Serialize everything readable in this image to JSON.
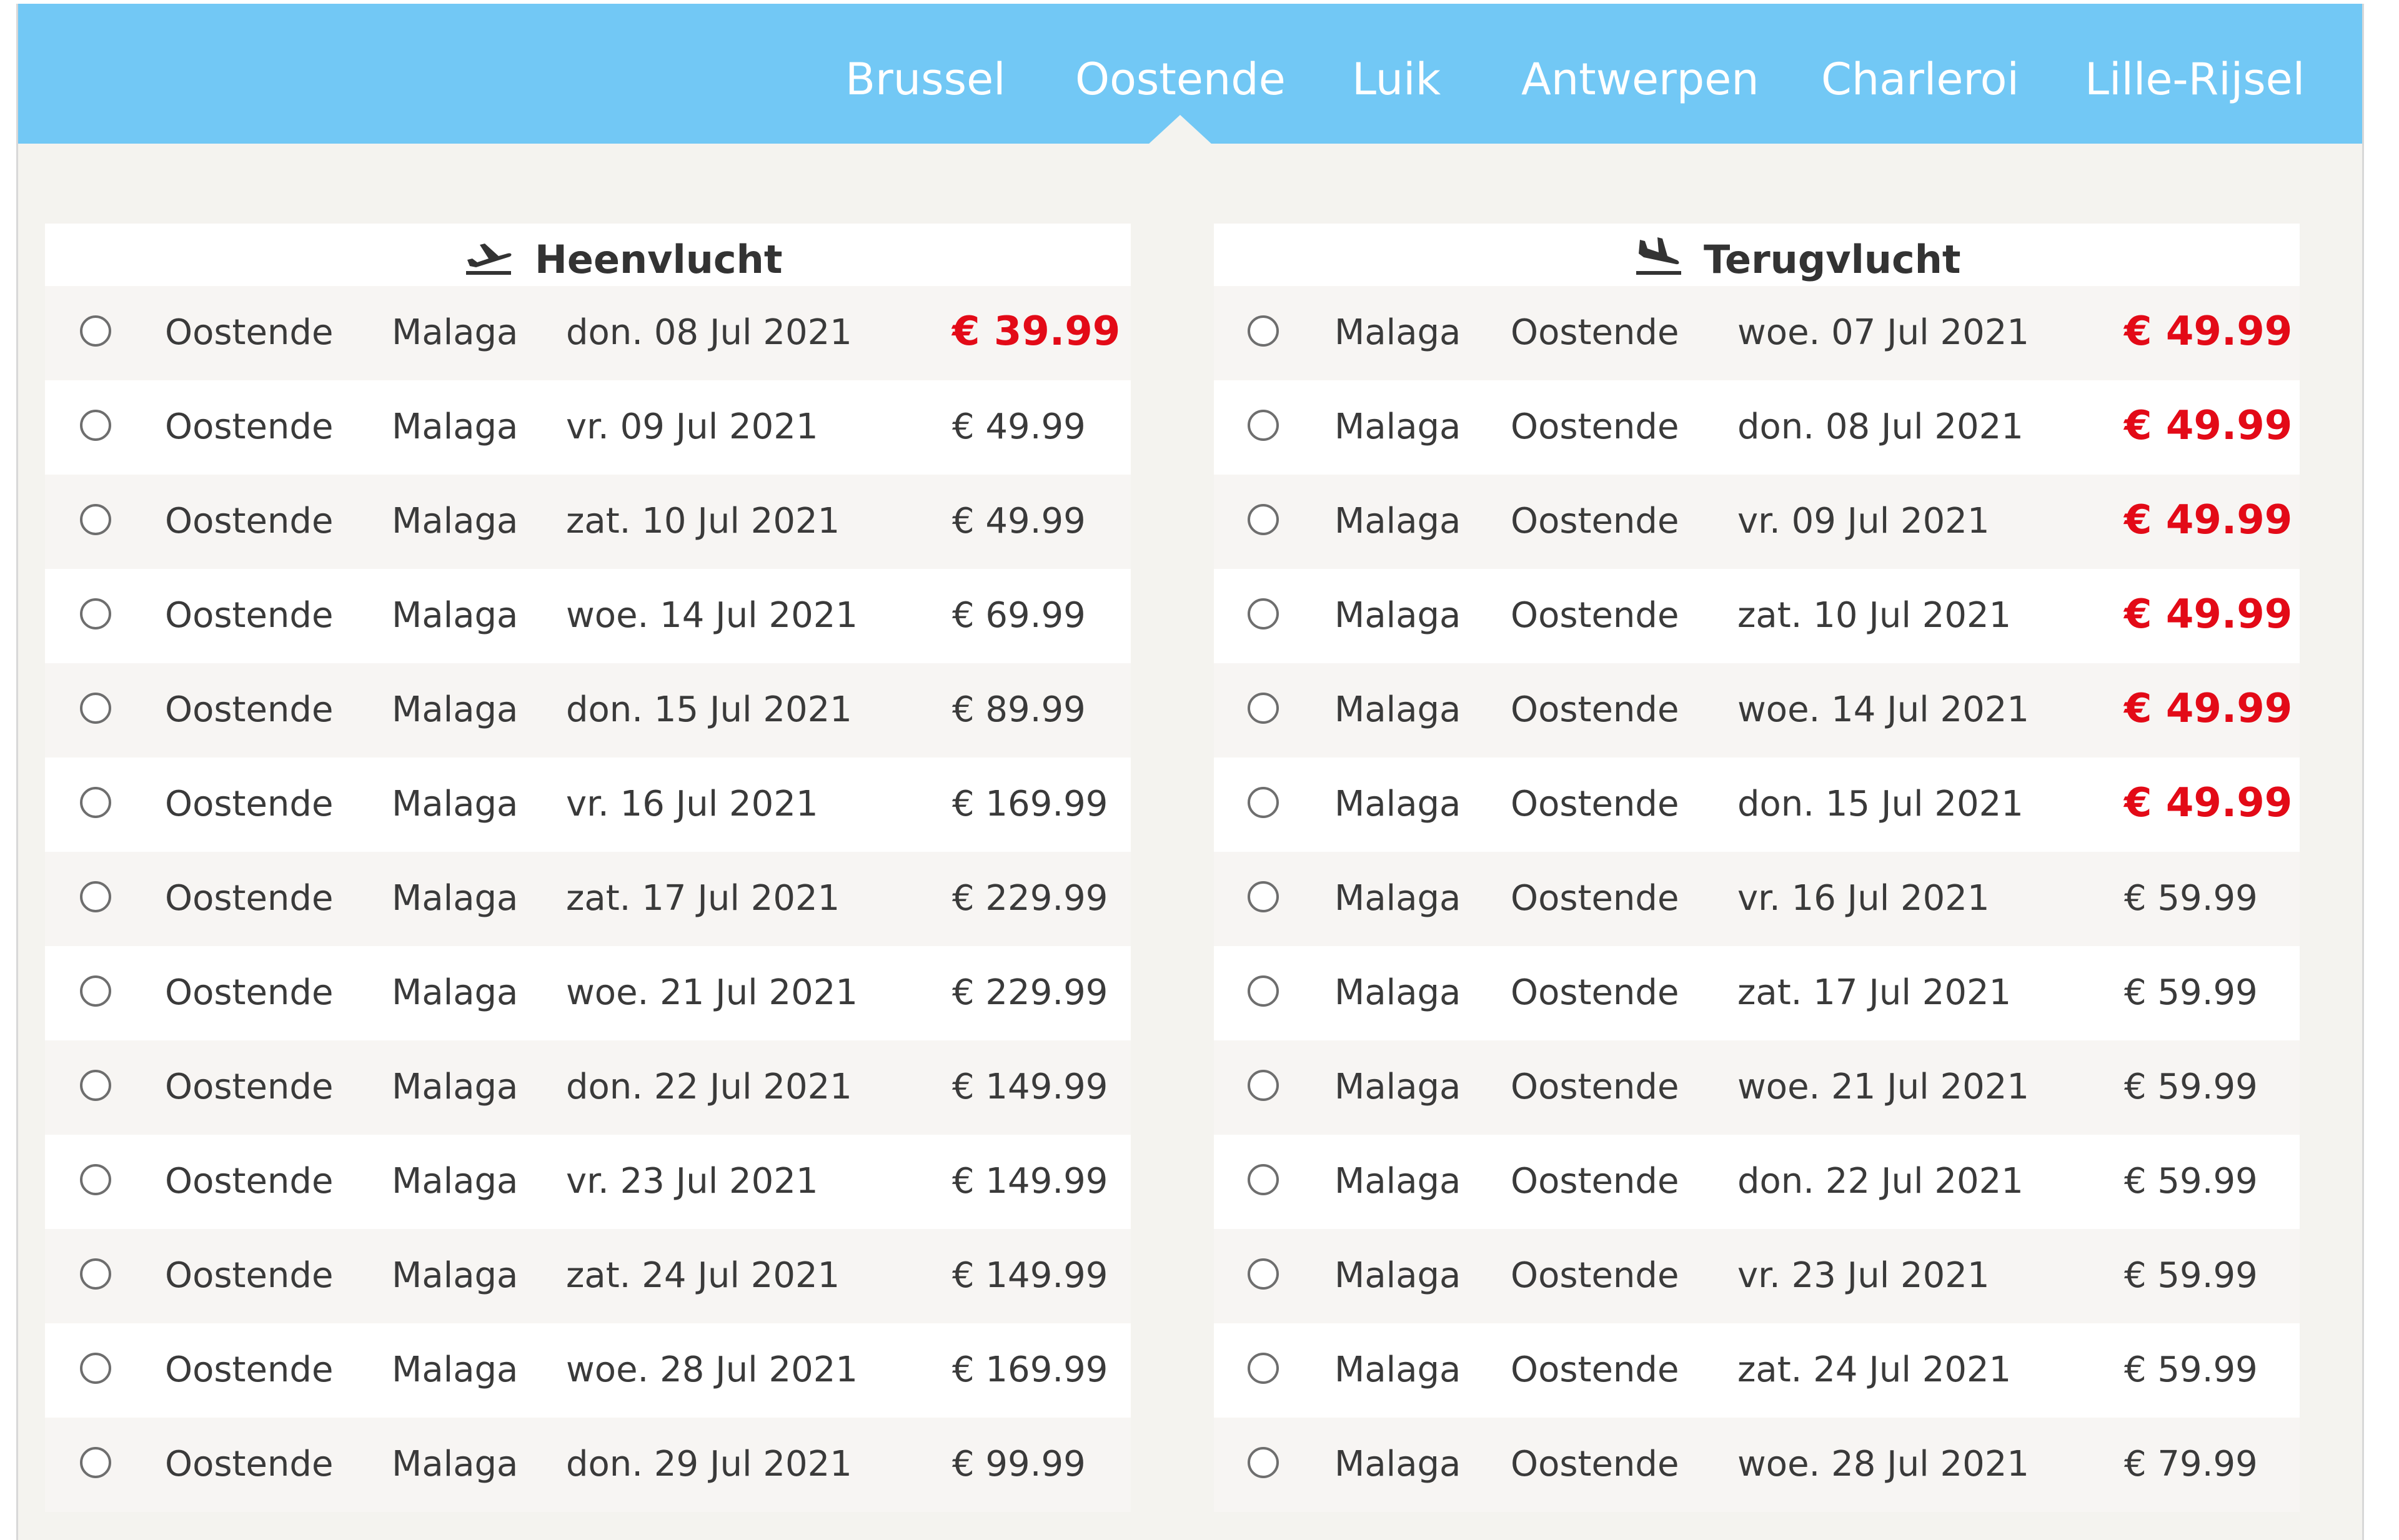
{
  "tabs": [
    {
      "label": "Brussel",
      "active": false
    },
    {
      "label": "Oostende",
      "active": true
    },
    {
      "label": "Luik",
      "active": false
    },
    {
      "label": "Antwerpen",
      "active": false
    },
    {
      "label": "Charleroi",
      "active": false
    },
    {
      "label": "Lille-Rijsel",
      "active": false
    }
  ],
  "colors": {
    "header": "#72c8f5",
    "price_highlight": "#e30a17",
    "background": "#f4f3ef"
  },
  "outbound": {
    "title": "Heenvlucht",
    "icon": "plane-departure-icon",
    "flights": [
      {
        "from": "Oostende",
        "to": "Malaga",
        "date": "don. 08 Jul 2021",
        "price": "€ 39.99",
        "highlight": true
      },
      {
        "from": "Oostende",
        "to": "Malaga",
        "date": "vr. 09 Jul 2021",
        "price": "€ 49.99",
        "highlight": false
      },
      {
        "from": "Oostende",
        "to": "Malaga",
        "date": "zat. 10 Jul 2021",
        "price": "€ 49.99",
        "highlight": false
      },
      {
        "from": "Oostende",
        "to": "Malaga",
        "date": "woe. 14 Jul 2021",
        "price": "€ 69.99",
        "highlight": false
      },
      {
        "from": "Oostende",
        "to": "Malaga",
        "date": "don. 15 Jul 2021",
        "price": "€ 89.99",
        "highlight": false
      },
      {
        "from": "Oostende",
        "to": "Malaga",
        "date": "vr. 16 Jul 2021",
        "price": "€ 169.99",
        "highlight": false
      },
      {
        "from": "Oostende",
        "to": "Malaga",
        "date": "zat. 17 Jul 2021",
        "price": "€ 229.99",
        "highlight": false
      },
      {
        "from": "Oostende",
        "to": "Malaga",
        "date": "woe. 21 Jul 2021",
        "price": "€ 229.99",
        "highlight": false
      },
      {
        "from": "Oostende",
        "to": "Malaga",
        "date": "don. 22 Jul 2021",
        "price": "€ 149.99",
        "highlight": false
      },
      {
        "from": "Oostende",
        "to": "Malaga",
        "date": "vr. 23 Jul 2021",
        "price": "€ 149.99",
        "highlight": false
      },
      {
        "from": "Oostende",
        "to": "Malaga",
        "date": "zat. 24 Jul 2021",
        "price": "€ 149.99",
        "highlight": false
      },
      {
        "from": "Oostende",
        "to": "Malaga",
        "date": "woe. 28 Jul 2021",
        "price": "€ 169.99",
        "highlight": false
      },
      {
        "from": "Oostende",
        "to": "Malaga",
        "date": "don. 29 Jul 2021",
        "price": "€ 99.99",
        "highlight": false
      }
    ]
  },
  "return": {
    "title": "Terugvlucht",
    "icon": "plane-arrival-icon",
    "flights": [
      {
        "from": "Malaga",
        "to": "Oostende",
        "date": "woe. 07 Jul 2021",
        "price": "€ 49.99",
        "highlight": true
      },
      {
        "from": "Malaga",
        "to": "Oostende",
        "date": "don. 08 Jul 2021",
        "price": "€ 49.99",
        "highlight": true
      },
      {
        "from": "Malaga",
        "to": "Oostende",
        "date": "vr. 09 Jul 2021",
        "price": "€ 49.99",
        "highlight": true
      },
      {
        "from": "Malaga",
        "to": "Oostende",
        "date": "zat. 10 Jul 2021",
        "price": "€ 49.99",
        "highlight": true
      },
      {
        "from": "Malaga",
        "to": "Oostende",
        "date": "woe. 14 Jul 2021",
        "price": "€ 49.99",
        "highlight": true
      },
      {
        "from": "Malaga",
        "to": "Oostende",
        "date": "don. 15 Jul 2021",
        "price": "€ 49.99",
        "highlight": true
      },
      {
        "from": "Malaga",
        "to": "Oostende",
        "date": "vr. 16 Jul 2021",
        "price": "€ 59.99",
        "highlight": false
      },
      {
        "from": "Malaga",
        "to": "Oostende",
        "date": "zat. 17 Jul 2021",
        "price": "€ 59.99",
        "highlight": false
      },
      {
        "from": "Malaga",
        "to": "Oostende",
        "date": "woe. 21 Jul 2021",
        "price": "€ 59.99",
        "highlight": false
      },
      {
        "from": "Malaga",
        "to": "Oostende",
        "date": "don. 22 Jul 2021",
        "price": "€ 59.99",
        "highlight": false
      },
      {
        "from": "Malaga",
        "to": "Oostende",
        "date": "vr. 23 Jul 2021",
        "price": "€ 59.99",
        "highlight": false
      },
      {
        "from": "Malaga",
        "to": "Oostende",
        "date": "zat. 24 Jul 2021",
        "price": "€ 59.99",
        "highlight": false
      },
      {
        "from": "Malaga",
        "to": "Oostende",
        "date": "woe. 28 Jul 2021",
        "price": "€ 79.99",
        "highlight": false
      }
    ]
  }
}
